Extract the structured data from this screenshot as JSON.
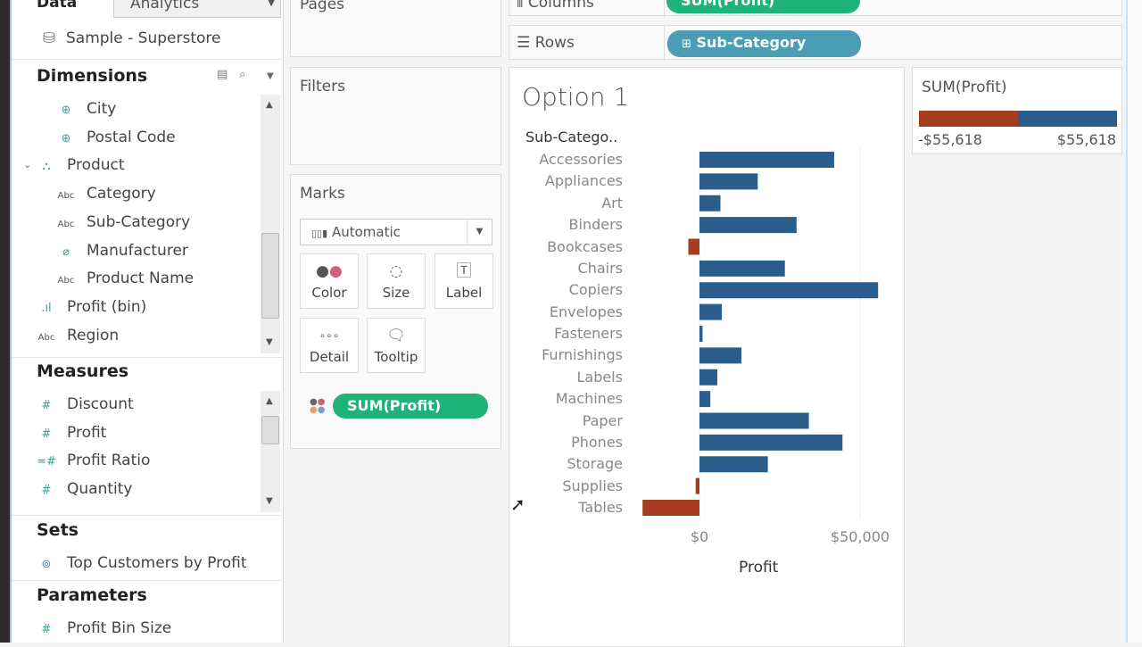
{
  "left_panel": {
    "tabs": [
      "Data",
      "Analytics"
    ],
    "datasource": "Sample - Superstore",
    "dimensions": {
      "title": "Dimensions",
      "items": [
        {
          "label": "City",
          "icon": "globe-icon",
          "indent": 2
        },
        {
          "label": "Postal Code",
          "icon": "globe-icon",
          "indent": 2
        },
        {
          "label": "Product",
          "icon": "hierarchy-icon",
          "indent": 1,
          "expanded": true
        },
        {
          "label": "Category",
          "icon": "abc-icon",
          "indent": 2
        },
        {
          "label": "Sub-Category",
          "icon": "abc-icon",
          "indent": 2
        },
        {
          "label": "Manufacturer",
          "icon": "paperclip-icon",
          "indent": 2
        },
        {
          "label": "Product Name",
          "icon": "abc-icon",
          "indent": 2
        },
        {
          "label": "Profit (bin)",
          "icon": "bin-icon",
          "indent": 1
        },
        {
          "label": "Region",
          "icon": "abc-icon",
          "indent": 1
        }
      ]
    },
    "measures": {
      "title": "Measures",
      "items": [
        {
          "label": "Discount",
          "icon": "hash-icon"
        },
        {
          "label": "Profit",
          "icon": "hash-icon"
        },
        {
          "label": "Profit Ratio",
          "icon": "calc-hash-icon"
        },
        {
          "label": "Quantity",
          "icon": "hash-icon"
        }
      ]
    },
    "sets": {
      "title": "Sets",
      "items": [
        {
          "label": "Top Customers by Profit",
          "icon": "set-icon"
        }
      ]
    },
    "parameters": {
      "title": "Parameters",
      "items": [
        {
          "label": "Profit Bin Size",
          "icon": "hash-icon"
        }
      ]
    }
  },
  "cards": {
    "pages": "Pages",
    "filters": "Filters",
    "marks": {
      "title": "Marks",
      "type": "Automatic",
      "buttons": [
        "Color",
        "Size",
        "Label",
        "Detail",
        "Tooltip"
      ],
      "pill": "SUM(Profit)"
    }
  },
  "shelves": {
    "columns_label": "Columns",
    "columns_pill": "SUM(Profit)",
    "rows_label": "Rows",
    "rows_pill": "Sub-Category"
  },
  "legend": {
    "title": "SUM(Profit)",
    "min": "-$55,618",
    "max": "$55,618"
  },
  "colors": {
    "positive": "#2a5d8c",
    "negative": "#a53b1f",
    "measure_pill": "#1fb37a",
    "dimension_pill": "#4a9db5"
  },
  "chart_data": {
    "type": "bar",
    "title": "Option 1",
    "row_header": "Sub-Catego..",
    "xlabel": "Profit",
    "categories": [
      "Accessories",
      "Appliances",
      "Art",
      "Binders",
      "Bookcases",
      "Chairs",
      "Copiers",
      "Envelopes",
      "Fasteners",
      "Furnishings",
      "Labels",
      "Machines",
      "Paper",
      "Phones",
      "Storage",
      "Supplies",
      "Tables"
    ],
    "values": [
      41937,
      18138,
      6528,
      30222,
      -3473,
      26590,
      55618,
      6964,
      950,
      13059,
      5546,
      3385,
      34054,
      44516,
      21279,
      -1189,
      -17725
    ],
    "xticks": [
      {
        "value": 0,
        "label": "$0"
      },
      {
        "value": 50000,
        "label": "$50,000"
      }
    ]
  }
}
